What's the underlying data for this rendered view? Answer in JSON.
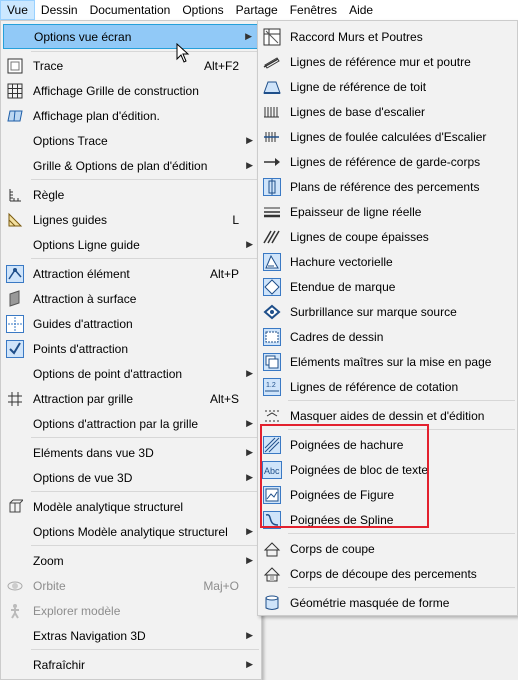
{
  "menubar": {
    "items": [
      {
        "label": "Vue",
        "active": true
      },
      {
        "label": "Dessin"
      },
      {
        "label": "Documentation"
      },
      {
        "label": "Options"
      },
      {
        "label": "Partage"
      },
      {
        "label": "Fenêtres"
      },
      {
        "label": "Aide"
      }
    ]
  },
  "main_menu": {
    "items": [
      {
        "label": "Options vue écran",
        "submenu": true,
        "highlighted": true
      },
      {
        "label": "Trace",
        "shortcut": "Alt+F2",
        "icon": "trace-icon"
      },
      {
        "label": "Affichage Grille de construction",
        "icon": "grid-icon"
      },
      {
        "label": "Affichage plan d'édition.",
        "icon": "edit-plane-icon"
      },
      {
        "label": "Options Trace",
        "submenu": true
      },
      {
        "label": "Grille & Options de plan d'édition",
        "submenu": true
      },
      {
        "label": "Règle",
        "icon": "ruler-icon"
      },
      {
        "label": "Lignes guides",
        "shortcut": "L",
        "icon": "guide-lines-icon"
      },
      {
        "label": "Options Ligne guide",
        "submenu": true
      },
      {
        "label": "Attraction élément",
        "shortcut": "Alt+P",
        "icon": "element-snap-icon"
      },
      {
        "label": "Attraction à surface",
        "icon": "surface-snap-icon"
      },
      {
        "label": "Guides d'attraction",
        "icon": "snap-guides-icon"
      },
      {
        "label": "Points d'attraction",
        "icon": "snap-points-icon"
      },
      {
        "label": "Options de point d'attraction",
        "submenu": true
      },
      {
        "label": "Attraction par grille",
        "shortcut": "Alt+S",
        "icon": "grid-snap-icon"
      },
      {
        "label": "Options d'attraction par la grille",
        "submenu": true
      },
      {
        "label": "Eléments dans vue 3D",
        "submenu": true
      },
      {
        "label": "Options de vue 3D",
        "submenu": true
      },
      {
        "label": "Modèle analytique structurel",
        "icon": "structural-model-icon"
      },
      {
        "label": "Options Modèle analytique structurel",
        "submenu": true
      },
      {
        "label": "Zoom",
        "submenu": true
      },
      {
        "label": "Orbite",
        "shortcut": "Maj+O",
        "disabled": true,
        "icon": "orbit-icon"
      },
      {
        "label": "Explorer modèle",
        "disabled": true,
        "icon": "explore-icon"
      },
      {
        "label": "Extras Navigation 3D",
        "submenu": true
      },
      {
        "label": "Rafraîchir",
        "submenu": true
      }
    ]
  },
  "sub_menu": {
    "items": [
      {
        "label": "Raccord Murs et Poutres",
        "icon": "wall-beam-junction-icon"
      },
      {
        "label": "Lignes de référence mur et poutre",
        "icon": "wall-reference-line-icon"
      },
      {
        "label": "Ligne de référence de toit",
        "icon": "roof-reference-line-icon"
      },
      {
        "label": "Lignes de base d'escalier",
        "icon": "stair-baseline-icon"
      },
      {
        "label": "Lignes de foulée calculées d'Escalier",
        "icon": "stair-walkline-icon"
      },
      {
        "label": "Lignes de référence de garde-corps",
        "icon": "railing-reference-icon"
      },
      {
        "label": "Plans de référence des percements",
        "icon": "opening-reference-plane-icon"
      },
      {
        "label": "Epaisseur de ligne réelle",
        "icon": "true-line-weight-icon"
      },
      {
        "label": "Lignes de coupe épaisses",
        "icon": "bold-cut-lines-icon"
      },
      {
        "label": "Hachure vectorielle",
        "icon": "vectorial-hatching-icon"
      },
      {
        "label": "Etendue de marque",
        "icon": "marker-range-icon"
      },
      {
        "label": "Surbrillance sur marque source",
        "icon": "source-marker-highlight-icon"
      },
      {
        "label": "Cadres de dessin",
        "icon": "drawing-frames-icon"
      },
      {
        "label": "Eléments maîtres sur la mise en page",
        "icon": "master-items-icon"
      },
      {
        "label": "Lignes de référence de cotation",
        "icon": "dimension-reference-icon"
      },
      {
        "label": "Masquer aides de dessin et d'édition",
        "icon": "hide-drawing-aids-icon"
      },
      {
        "label": "Poignées de hachure",
        "icon": "fill-handles-icon"
      },
      {
        "label": "Poignées de bloc de texte",
        "icon": "text-block-handles-icon"
      },
      {
        "label": "Poignées de Figure",
        "icon": "figure-handles-icon"
      },
      {
        "label": "Poignées de Spline",
        "icon": "spline-handles-icon"
      },
      {
        "label": "Corps de coupe",
        "icon": "cut-body-icon"
      },
      {
        "label": "Corps de découpe des percements",
        "icon": "opening-cut-body-icon"
      },
      {
        "label": "Géométrie masquée de forme",
        "icon": "shell-hidden-geometry-icon"
      }
    ]
  },
  "colors": {
    "highlight": "#91c9f7",
    "highlight_border": "#26a0da",
    "menubar_active": "#cce8ff",
    "annotation_box": "#e3212e"
  }
}
